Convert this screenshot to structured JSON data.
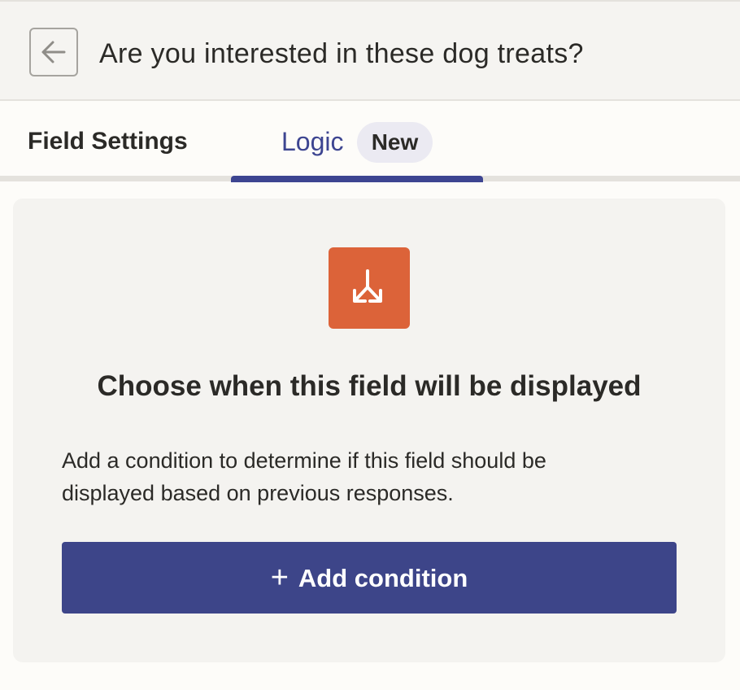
{
  "header": {
    "title": "Are you interested in these dog treats?",
    "back_icon": "arrow-left-icon"
  },
  "tabs": [
    {
      "label": "Field Settings",
      "active": false
    },
    {
      "label": "Logic",
      "badge": "New",
      "active": true
    }
  ],
  "panel": {
    "icon": "split-arrows-icon",
    "title": "Choose when this field will be displayed",
    "description": "Add a condition to determine if this field should be displayed based on previous responses.",
    "button": {
      "icon": "+",
      "label": "Add condition"
    }
  },
  "colors": {
    "accent": "#3d4591",
    "button": "#3d4589",
    "icon_bg": "#dc6339",
    "badge_bg": "#ebeaf2"
  }
}
